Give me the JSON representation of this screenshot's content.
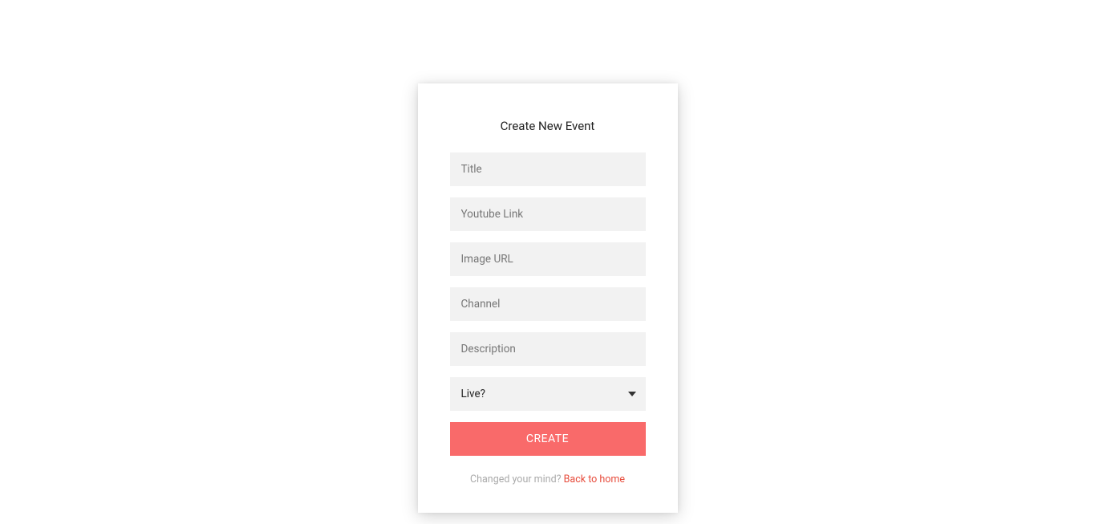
{
  "form": {
    "title": "Create New Event",
    "fields": {
      "title_placeholder": "Title",
      "youtube_placeholder": "Youtube Link",
      "image_url_placeholder": "Image URL",
      "channel_placeholder": "Channel",
      "description_placeholder": "Description",
      "live_label": "Live?"
    },
    "submit_label": "Create",
    "footer": {
      "prompt": "Changed your mind? ",
      "link_text": "Back to home"
    }
  }
}
